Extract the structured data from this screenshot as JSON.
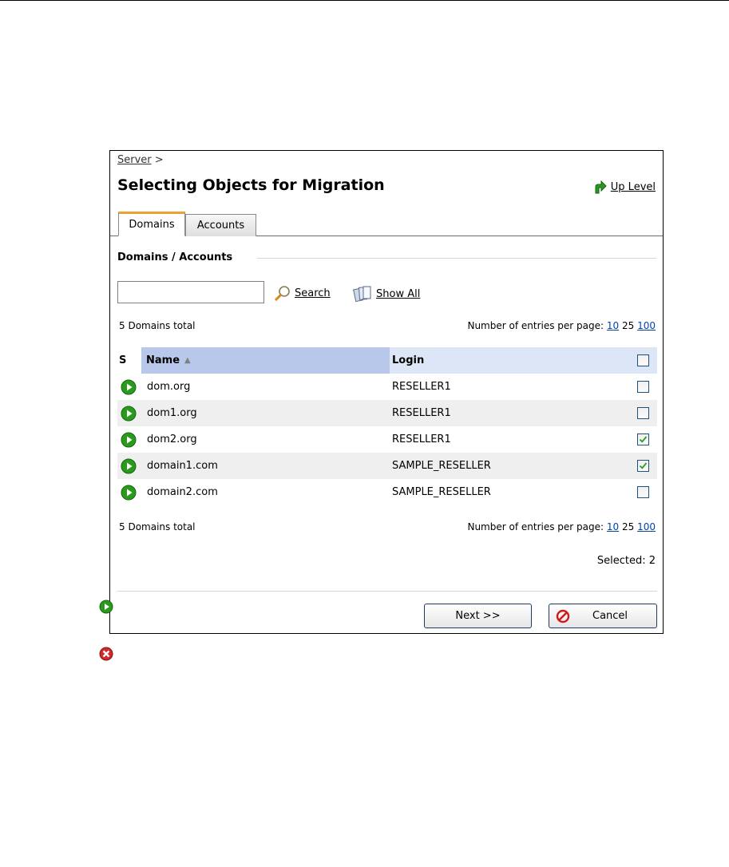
{
  "breadcrumb": {
    "link": "Server",
    "separator": ">"
  },
  "page_title": "Selecting Objects for Migration",
  "up_level_label": "Up Level",
  "tabs": [
    {
      "label": "Domains",
      "active": true
    },
    {
      "label": "Accounts",
      "active": false
    }
  ],
  "section_title": "Domains / Accounts",
  "search": {
    "value": "",
    "placeholder": "",
    "search_label": "Search",
    "show_all_label": "Show All"
  },
  "summary": {
    "total_text": "5 Domains total",
    "per_page_label": "Number of entries per page:",
    "per_page_options": [
      "10",
      "25",
      "100"
    ],
    "per_page_current": "25"
  },
  "table": {
    "headers": {
      "status": "S",
      "name": "Name",
      "login": "Login"
    },
    "rows": [
      {
        "name": "dom.org",
        "login": "RESELLER1",
        "checked": false
      },
      {
        "name": "dom1.org",
        "login": "RESELLER1",
        "checked": false
      },
      {
        "name": "dom2.org",
        "login": "RESELLER1",
        "checked": true
      },
      {
        "name": "domain1.com",
        "login": "SAMPLE_RESELLER",
        "checked": true
      },
      {
        "name": "domain2.com",
        "login": "SAMPLE_RESELLER",
        "checked": false
      }
    ]
  },
  "selected_text": "Selected: 2",
  "buttons": {
    "next": "Next >>",
    "cancel": "Cancel"
  },
  "icons": {
    "status_ok": "green-play-icon",
    "status_error": "red-x-icon",
    "up_level": "green-up-arrow-icon",
    "search": "magnifier-icon",
    "show_all": "documents-icon",
    "cancel": "no-entry-icon"
  },
  "colors": {
    "link": "#0044aa",
    "status_ok": "#2a9a1c",
    "status_error": "#cc2222",
    "tab_accent": "#f0a030"
  }
}
